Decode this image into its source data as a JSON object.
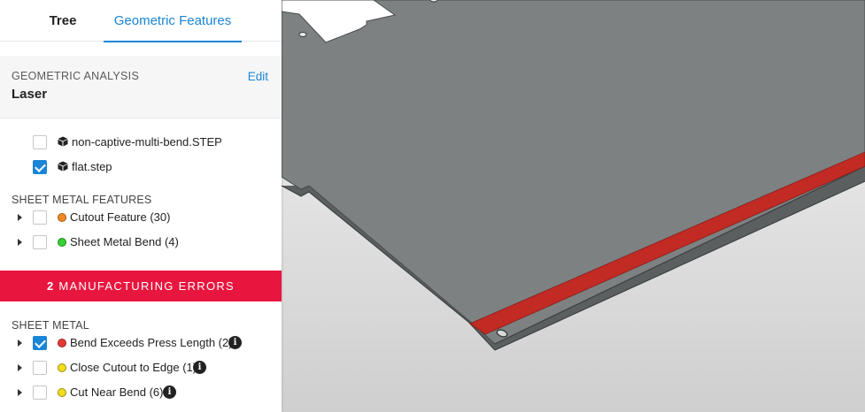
{
  "tabs": {
    "tree": "Tree",
    "geometric_features": "Geometric Features",
    "active": "Geometric Features"
  },
  "analysis": {
    "label": "GEOMETRIC ANALYSIS",
    "value": "Laser",
    "edit": "Edit"
  },
  "files": [
    {
      "name": "non-captive-multi-bend.STEP",
      "checked": false
    },
    {
      "name": "flat.step",
      "checked": true
    }
  ],
  "sheet_metal_features": {
    "heading": "SHEET METAL FEATURES",
    "items": [
      {
        "label": "Cutout Feature (30)",
        "color": "#f08a24",
        "checked": false
      },
      {
        "label": "Sheet Metal Bend (4)",
        "color": "#35d135",
        "checked": false
      }
    ]
  },
  "errors_banner": {
    "count": "2",
    "text": "MANUFACTURING ERRORS",
    "color": "#e8163f"
  },
  "sheet_metal": {
    "heading": "SHEET METAL",
    "items": [
      {
        "label": "Bend Exceeds Press Length (2)",
        "color": "#e53935",
        "checked": true
      },
      {
        "label": "Close Cutout to Edge (1)",
        "color": "#f2dc1c",
        "checked": false
      },
      {
        "label": "Cut Near Bend (6)",
        "color": "#f2dc1c",
        "checked": false
      }
    ]
  },
  "viewport": {
    "part_color": "#7d8182",
    "highlight_color": "#c12b24"
  }
}
